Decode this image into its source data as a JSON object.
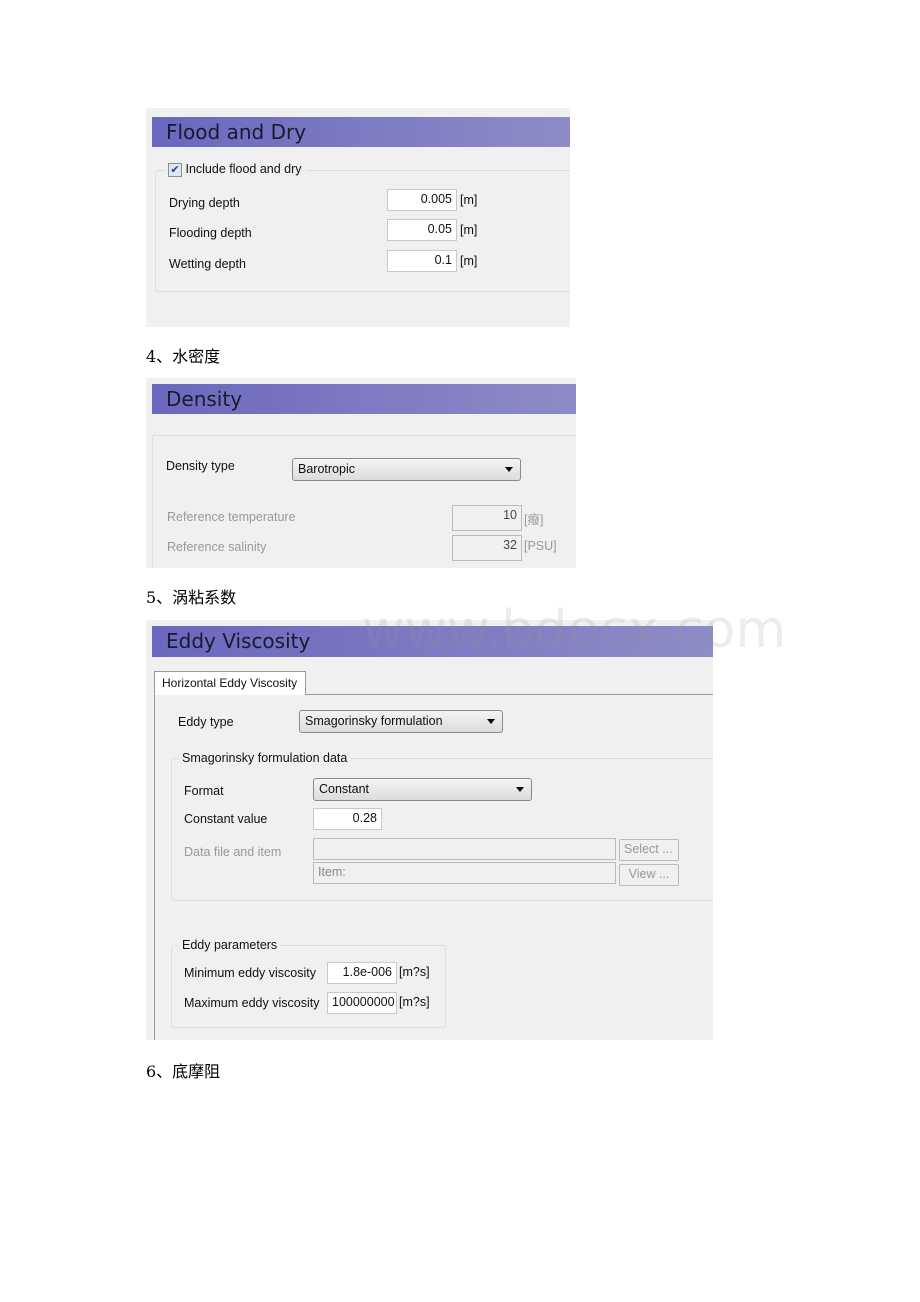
{
  "flood_dry": {
    "title": "Flood and Dry",
    "include_label": "Include flood and dry",
    "include_checked": true,
    "rows": [
      {
        "label": "Drying depth",
        "value": "0.005",
        "unit": "[m]"
      },
      {
        "label": "Flooding depth",
        "value": "0.05",
        "unit": "[m]"
      },
      {
        "label": "Wetting depth",
        "value": "0.1",
        "unit": "[m]"
      }
    ]
  },
  "heading4": "4、水密度",
  "density": {
    "title": "Density",
    "type_label": "Density type",
    "type_value": "Barotropic",
    "rows": [
      {
        "label": "Reference temperature",
        "value": "10",
        "unit": "[癈]"
      },
      {
        "label": "Reference salinity",
        "value": "32",
        "unit": "[PSU]"
      }
    ]
  },
  "heading5": "5、涡粘系数",
  "watermark": "www.bdocx.com",
  "eddy": {
    "title": "Eddy Viscosity",
    "tab": "Horizontal Eddy Viscosity",
    "type_label": "Eddy type",
    "type_value": "Smagorinsky formulation",
    "smag_group": "Smagorinsky formulation data",
    "format_label": "Format",
    "format_value": "Constant",
    "const_label": "Constant value",
    "const_value": "0.28",
    "datafile_label": "Data file and item",
    "datafile_value": "",
    "item_value": "Item:",
    "select_btn": "Select ...",
    "view_btn": "View ...",
    "params_group": "Eddy parameters",
    "params": [
      {
        "label": "Minimum eddy viscosity",
        "value": "1.8e-006",
        "unit": "[m?s]"
      },
      {
        "label": "Maximum eddy viscosity",
        "value": "100000000",
        "unit": "[m?s]"
      }
    ]
  },
  "heading6": "6、底摩阻",
  "colors": {
    "header_start": "#6a68be",
    "header_end": "#8e8cc6",
    "panel_bg": "#f0f0f0"
  }
}
